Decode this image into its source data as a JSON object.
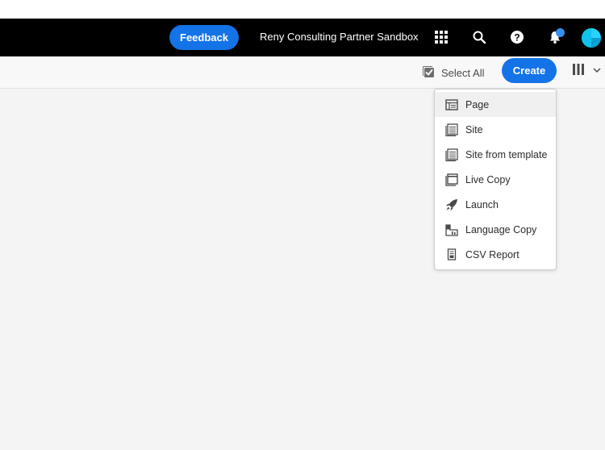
{
  "shell": {
    "feedback_label": "Feedback",
    "org_name": "Reny Consulting Partner Sandbox",
    "icons": [
      "apps-icon",
      "search-icon",
      "help-icon",
      "bell-icon",
      "avatar"
    ],
    "colors": {
      "bar": "#000000",
      "accent": "#1473e6",
      "notification_dot": "#378ef0"
    }
  },
  "actionbar": {
    "select_all_label": "Select All",
    "create_label": "Create",
    "view_icon": "column-view-icon"
  },
  "create_menu": {
    "items": [
      {
        "label": "Page",
        "icon": "page-icon"
      },
      {
        "label": "Site",
        "icon": "site-icon"
      },
      {
        "label": "Site from template",
        "icon": "site-template-icon"
      },
      {
        "label": "Live Copy",
        "icon": "live-copy-icon"
      },
      {
        "label": "Launch",
        "icon": "launch-icon"
      },
      {
        "label": "Language Copy",
        "icon": "language-copy-icon"
      },
      {
        "label": "CSV Report",
        "icon": "csv-report-icon"
      }
    ]
  }
}
